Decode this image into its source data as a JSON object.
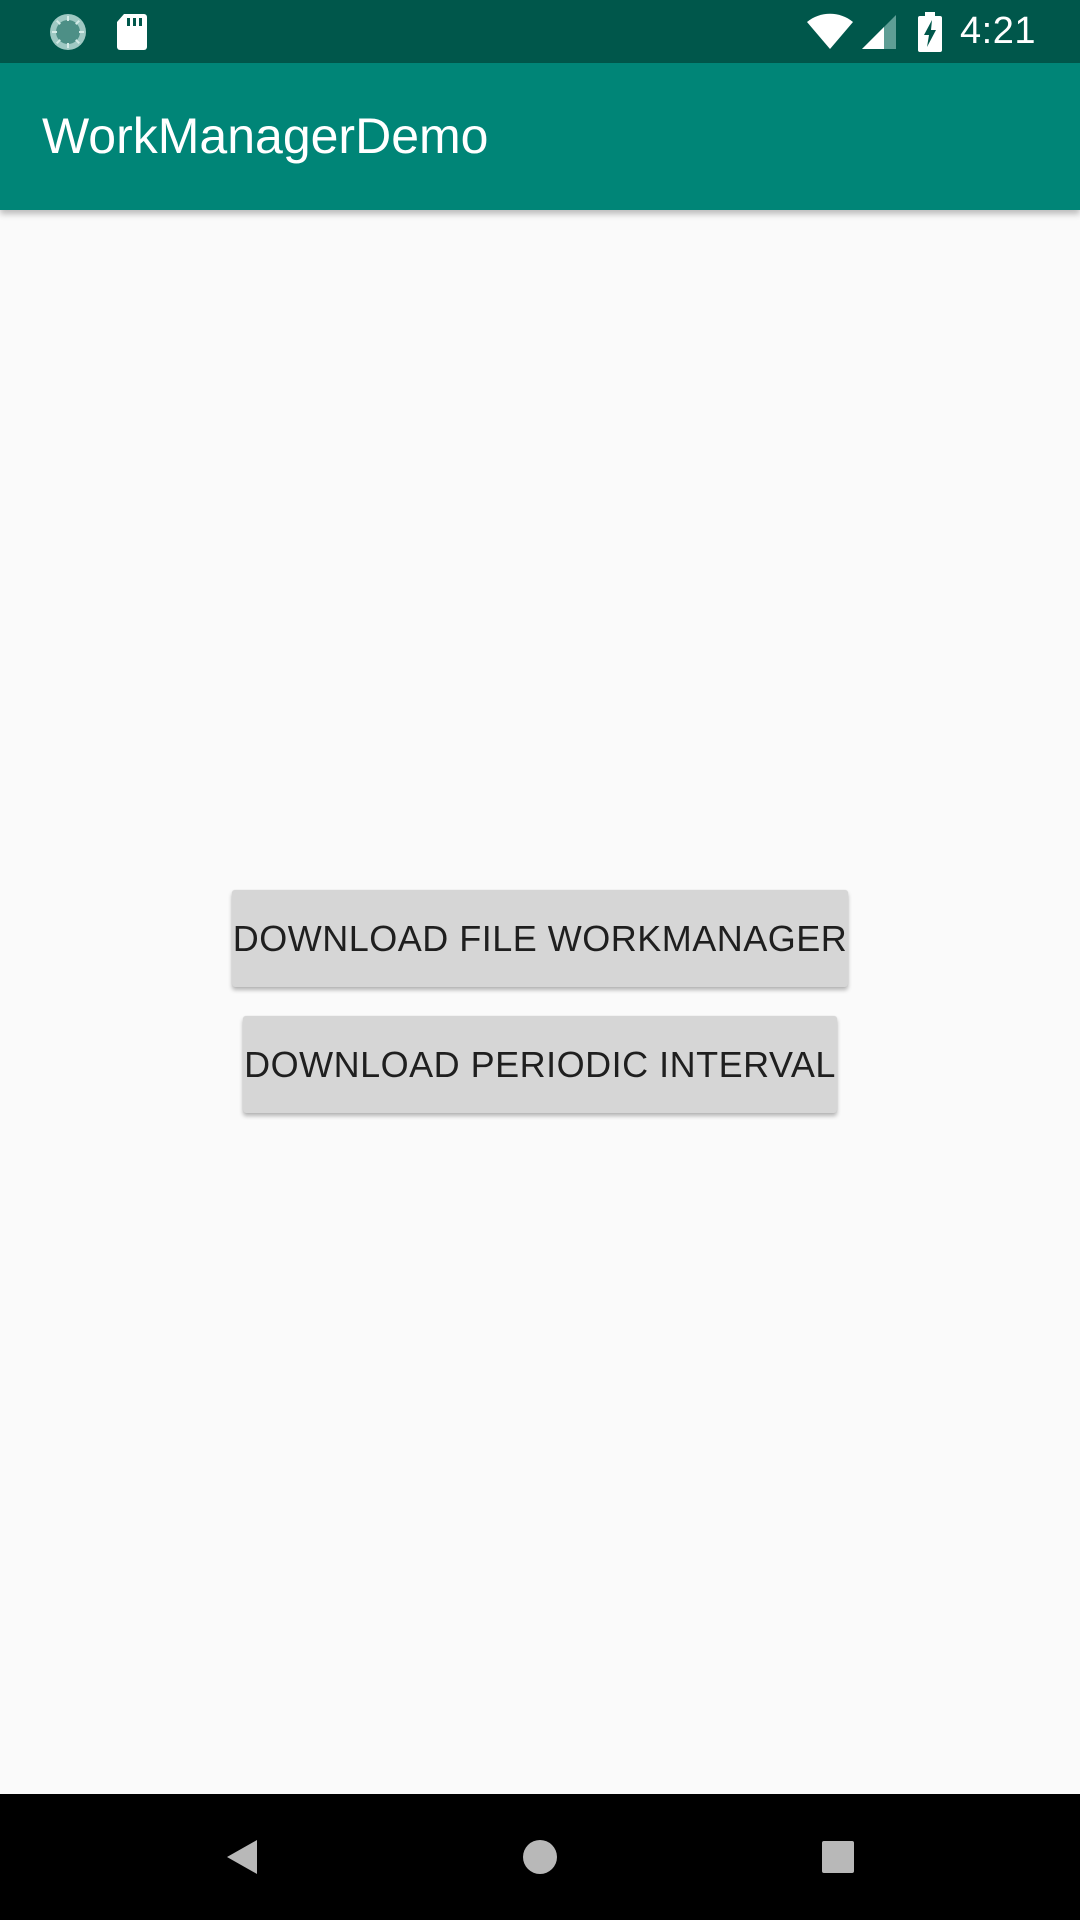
{
  "status_bar": {
    "time": "4:21",
    "left_icons": [
      "sync-icon",
      "sd-card-icon"
    ],
    "right_icons": [
      "wifi-icon",
      "cell-signal-icon",
      "battery-charging-icon"
    ],
    "background": "#00574b"
  },
  "app_bar": {
    "title": "WorkManagerDemo",
    "background": "#008577"
  },
  "main": {
    "buttons": [
      {
        "label": "DOWNLOAD FILE WORKMANAGER"
      },
      {
        "label": "DOWNLOAD PERIODIC INTERVAL"
      }
    ]
  },
  "nav_bar": {
    "icons": [
      "back-icon",
      "home-icon",
      "recents-icon"
    ]
  }
}
